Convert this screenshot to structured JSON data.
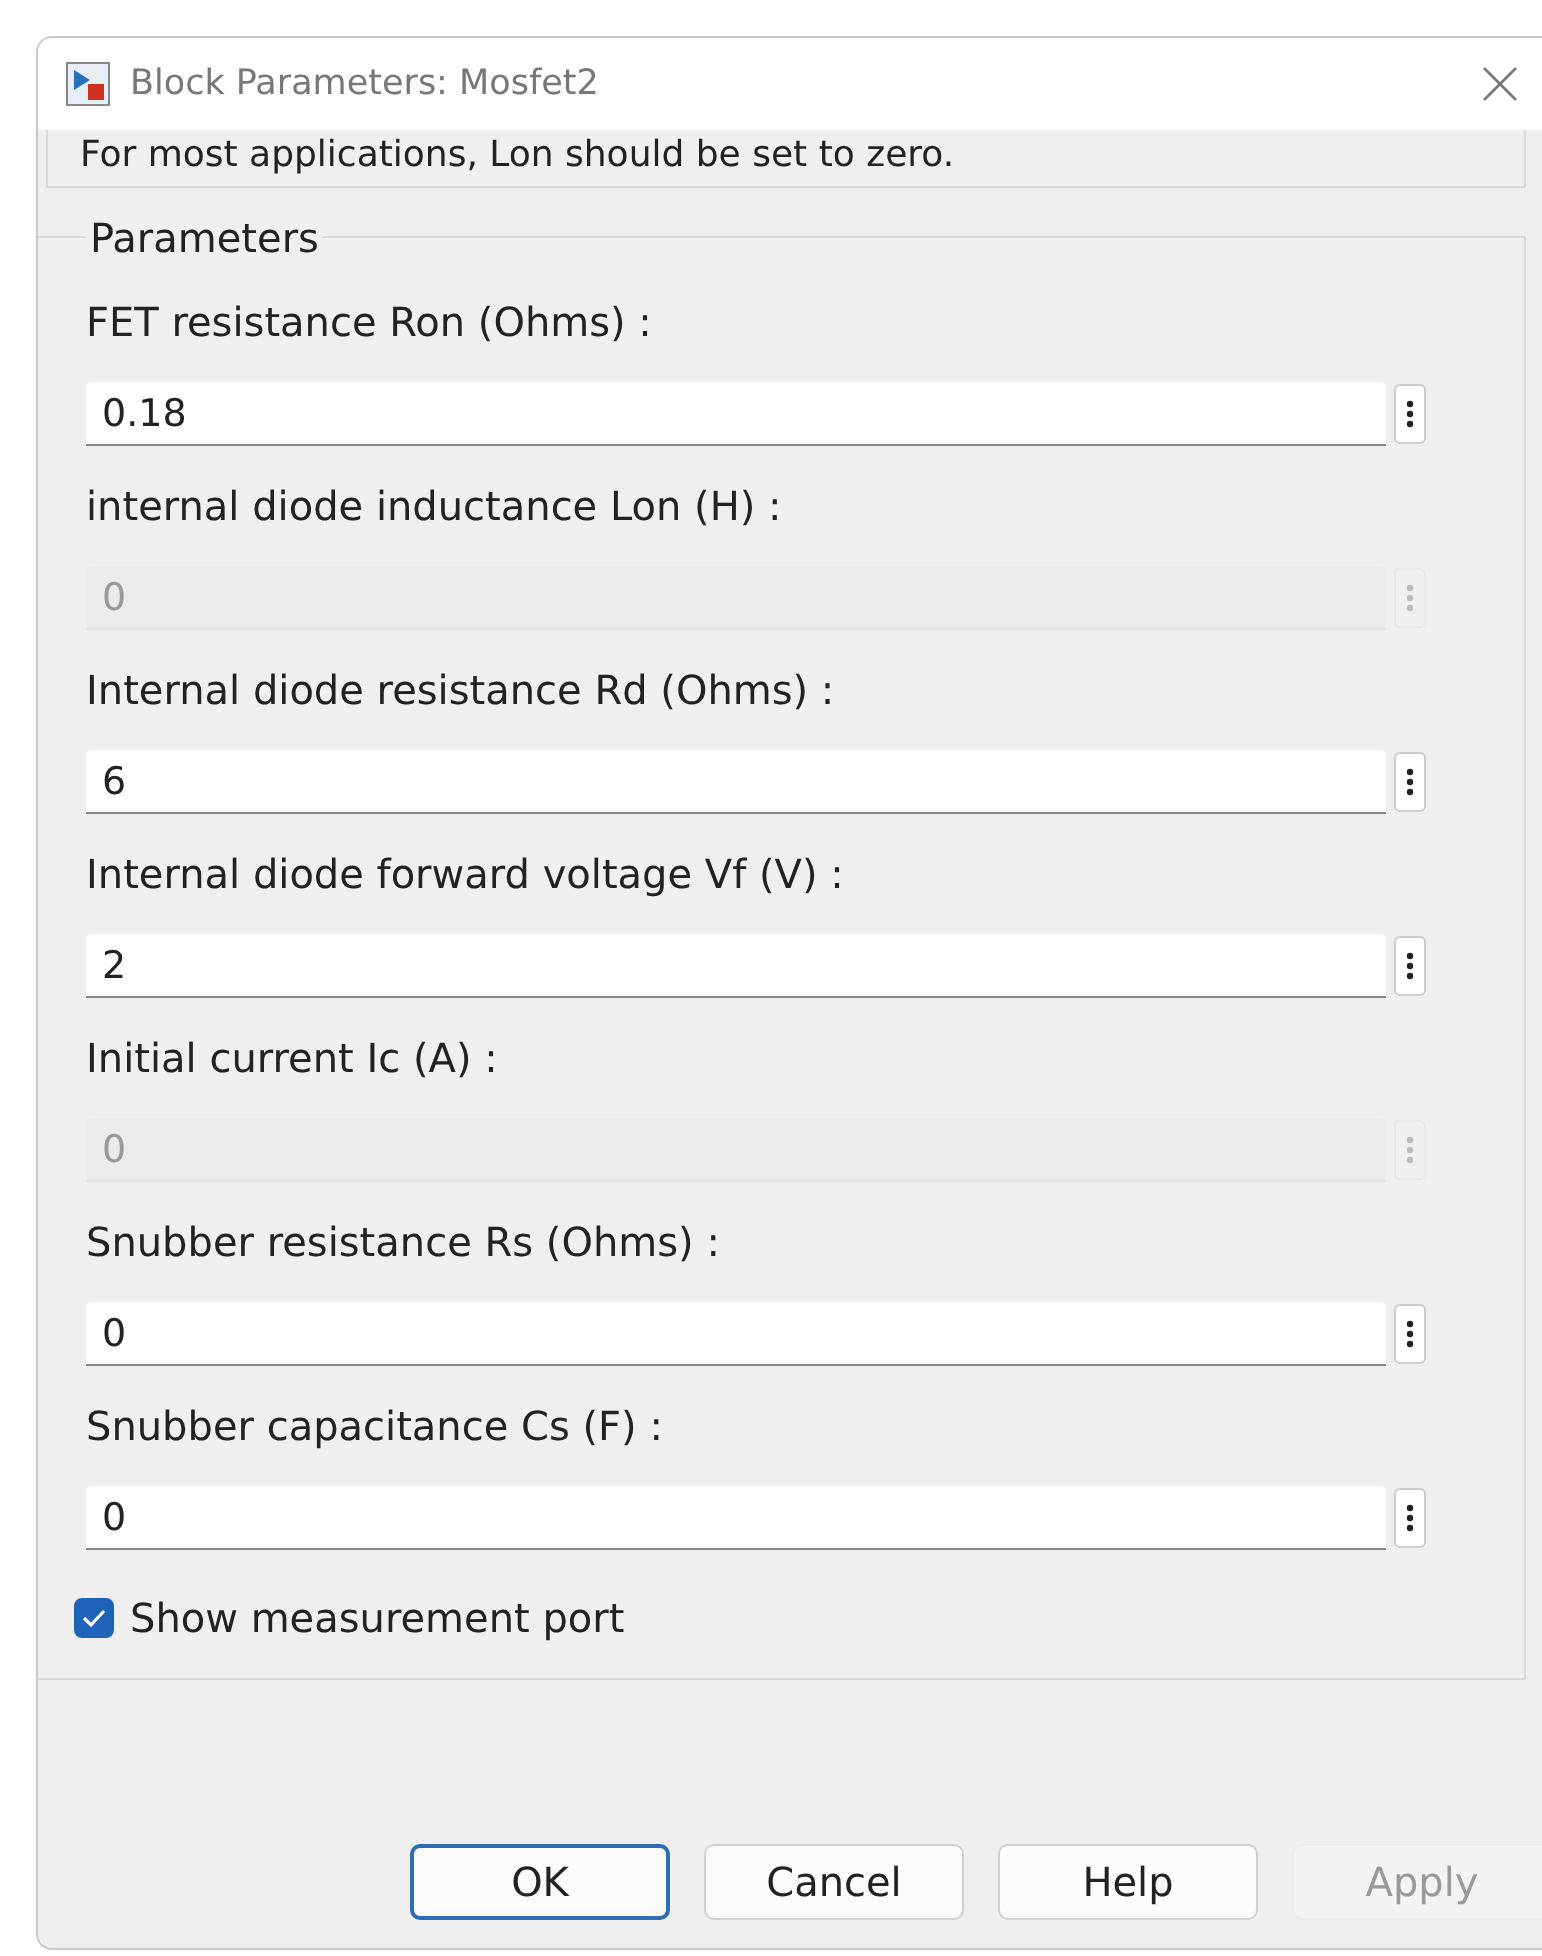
{
  "window": {
    "title": "Block Parameters: Mosfet2"
  },
  "description": "For most applications, Lon should be set to zero.",
  "parameters": {
    "title": "Parameters",
    "fields": [
      {
        "label": "FET resistance Ron (Ohms) :",
        "value": "0.18",
        "disabled": false
      },
      {
        "label": "internal diode inductance Lon (H) :",
        "value": "0",
        "disabled": true
      },
      {
        "label": "Internal diode resistance Rd  (Ohms) :",
        "value": "6",
        "disabled": false
      },
      {
        "label": "Internal diode forward voltage Vf (V) :",
        "value": "2",
        "disabled": false
      },
      {
        "label": "Initial current Ic (A) :",
        "value": "0",
        "disabled": true
      },
      {
        "label": "Snubber resistance Rs (Ohms) :",
        "value": "0",
        "disabled": false
      },
      {
        "label": "Snubber capacitance Cs (F) :",
        "value": "0",
        "disabled": false
      }
    ],
    "checkbox": {
      "label": "Show measurement port",
      "checked": true
    }
  },
  "buttons": [
    {
      "label": "OK",
      "default": true,
      "disabled": false
    },
    {
      "label": "Cancel",
      "default": false,
      "disabled": false
    },
    {
      "label": "Help",
      "default": false,
      "disabled": false
    },
    {
      "label": "Apply",
      "default": false,
      "disabled": true
    }
  ]
}
